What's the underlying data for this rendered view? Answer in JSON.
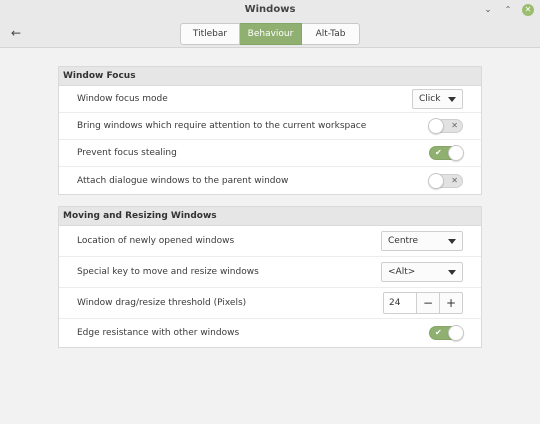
{
  "window": {
    "title": "Windows",
    "minimize_glyph": "⌄",
    "maximize_glyph": "⌃",
    "close_glyph": "✕"
  },
  "header": {
    "back_icon": "←",
    "tabs": [
      {
        "label": "Titlebar"
      },
      {
        "label": "Behaviour",
        "active": true
      },
      {
        "label": "Alt-Tab"
      }
    ]
  },
  "sections": [
    {
      "title": "Window Focus",
      "rows": [
        {
          "label": "Window focus mode",
          "control": "dropdown",
          "value": "Click"
        },
        {
          "label": "Bring windows which require attention to the current workspace",
          "control": "toggle",
          "on": false
        },
        {
          "label": "Prevent focus stealing",
          "control": "toggle",
          "on": true
        },
        {
          "label": "Attach dialogue windows to the parent window",
          "control": "toggle",
          "on": false
        }
      ]
    },
    {
      "title": "Moving and Resizing Windows",
      "rows": [
        {
          "label": "Location of newly opened windows",
          "control": "dropdown",
          "value": "Centre"
        },
        {
          "label": "Special key to move and resize windows",
          "control": "dropdown",
          "value": "<Alt>"
        },
        {
          "label": "Window drag/resize threshold (Pixels)",
          "control": "spin",
          "value": "24",
          "minus": "−",
          "plus": "+"
        },
        {
          "label": "Edge resistance with other windows",
          "control": "toggle",
          "on": true
        }
      ]
    }
  ],
  "toggle_marks": {
    "on": "✔",
    "off": "✕"
  },
  "colors": {
    "accent": "#8fb070",
    "background": "#f2f2f2",
    "panel": "#ffffff"
  }
}
